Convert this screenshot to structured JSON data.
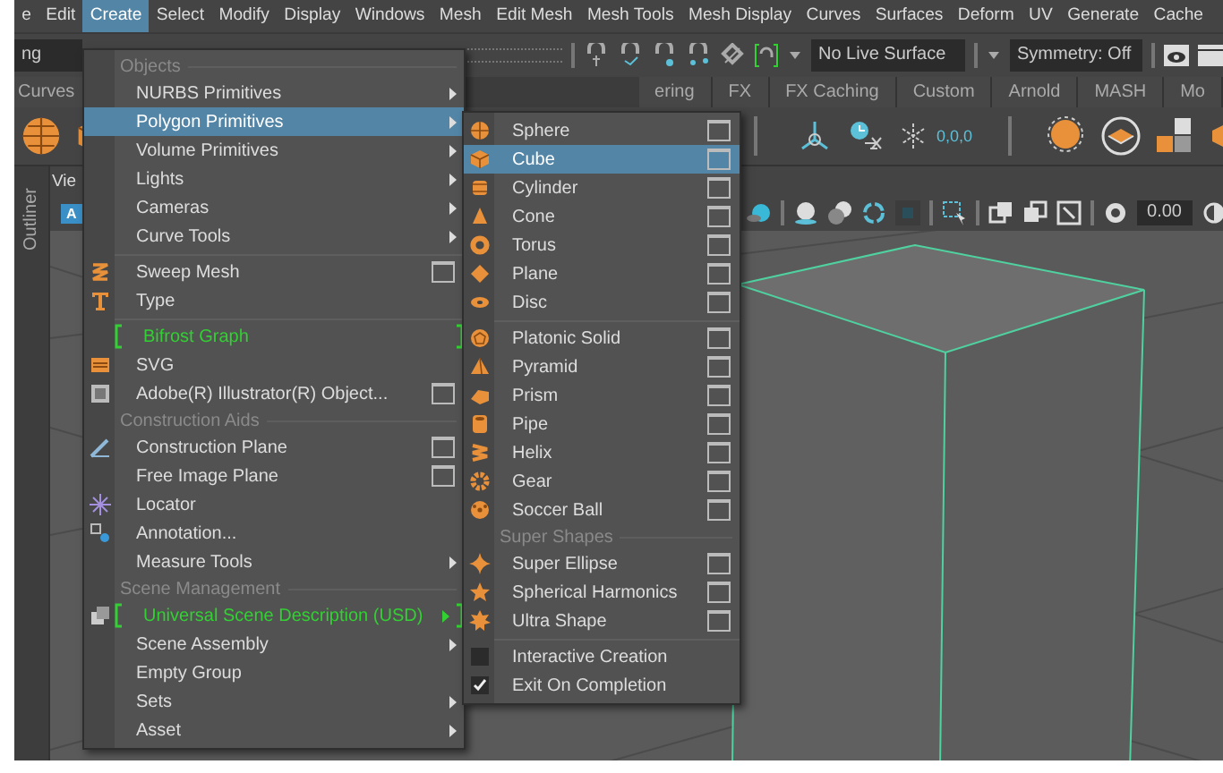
{
  "menubar": [
    {
      "label": "e",
      "selected": false
    },
    {
      "label": "Edit",
      "selected": false
    },
    {
      "label": "Create",
      "selected": true
    },
    {
      "label": "Select",
      "selected": false
    },
    {
      "label": "Modify",
      "selected": false
    },
    {
      "label": "Display",
      "selected": false
    },
    {
      "label": "Windows",
      "selected": false
    },
    {
      "label": "Mesh",
      "selected": false
    },
    {
      "label": "Edit Mesh",
      "selected": false
    },
    {
      "label": "Mesh Tools",
      "selected": false
    },
    {
      "label": "Mesh Display",
      "selected": false
    },
    {
      "label": "Curves",
      "selected": false
    },
    {
      "label": "Surfaces",
      "selected": false
    },
    {
      "label": "Deform",
      "selected": false
    },
    {
      "label": "UV",
      "selected": false
    },
    {
      "label": "Generate",
      "selected": false
    },
    {
      "label": "Cache",
      "selected": false
    }
  ],
  "toolbar": {
    "field": "ng",
    "live_surface": "No Live Surface",
    "symmetry": "Symmetry: Off"
  },
  "shelf_tabs": [
    "Curves",
    "ering",
    "FX",
    "FX Caching",
    "Custom",
    "Arnold",
    "MASH",
    "Mo"
  ],
  "shelf": {
    "origin_reading": "0,0,0"
  },
  "outliner_tab": "Outliner",
  "viewport": {
    "panel_menu": "Vie",
    "badge": "A",
    "camera_value": "0.00"
  },
  "create_menu": {
    "items": [
      {
        "kind": "section",
        "label": "Objects"
      },
      {
        "kind": "item",
        "label": "NURBS Primitives",
        "selected": false,
        "submenu": true
      },
      {
        "kind": "item",
        "label": "Polygon Primitives",
        "selected": true,
        "submenu": true
      },
      {
        "kind": "item",
        "label": "Volume Primitives",
        "selected": false,
        "submenu": true
      },
      {
        "kind": "item",
        "label": "Lights",
        "selected": false,
        "submenu": true
      },
      {
        "kind": "item",
        "label": "Cameras",
        "selected": false,
        "submenu": true
      },
      {
        "kind": "item",
        "label": "Curve Tools",
        "selected": false,
        "submenu": true
      },
      {
        "kind": "divider"
      },
      {
        "kind": "item",
        "label": "Sweep Mesh",
        "selected": false,
        "option_box": true
      },
      {
        "kind": "item",
        "label": "Type",
        "selected": false
      },
      {
        "kind": "divider"
      },
      {
        "kind": "item",
        "label": "Bifrost Graph",
        "selected": false,
        "plugin": true
      },
      {
        "kind": "item",
        "label": "SVG",
        "selected": false
      },
      {
        "kind": "item",
        "label": "Adobe(R) Illustrator(R) Object...",
        "selected": false,
        "option_box": true
      },
      {
        "kind": "section",
        "label": "Construction Aids"
      },
      {
        "kind": "item",
        "label": "Construction Plane",
        "selected": false,
        "option_box": true
      },
      {
        "kind": "item",
        "label": "Free Image Plane",
        "selected": false,
        "option_box": true
      },
      {
        "kind": "item",
        "label": "Locator",
        "selected": false
      },
      {
        "kind": "item",
        "label": "Annotation...",
        "selected": false
      },
      {
        "kind": "item",
        "label": "Measure Tools",
        "selected": false,
        "submenu": true
      },
      {
        "kind": "section",
        "label": "Scene Management"
      },
      {
        "kind": "item",
        "label": "Universal Scene Description (USD)",
        "selected": false,
        "submenu": true,
        "plugin": true
      },
      {
        "kind": "item",
        "label": "Scene Assembly",
        "selected": false,
        "submenu": true
      },
      {
        "kind": "item",
        "label": "Empty Group",
        "selected": false
      },
      {
        "kind": "item",
        "label": "Sets",
        "selected": false,
        "submenu": true
      },
      {
        "kind": "item",
        "label": "Asset",
        "selected": false,
        "submenu": true
      }
    ]
  },
  "submenu": {
    "items": [
      {
        "kind": "item",
        "label": "Sphere",
        "selected": false,
        "option_box": true
      },
      {
        "kind": "item",
        "label": "Cube",
        "selected": true,
        "option_box": true
      },
      {
        "kind": "item",
        "label": "Cylinder",
        "selected": false,
        "option_box": true
      },
      {
        "kind": "item",
        "label": "Cone",
        "selected": false,
        "option_box": true
      },
      {
        "kind": "item",
        "label": "Torus",
        "selected": false,
        "option_box": true
      },
      {
        "kind": "item",
        "label": "Plane",
        "selected": false,
        "option_box": true
      },
      {
        "kind": "item",
        "label": "Disc",
        "selected": false,
        "option_box": true
      },
      {
        "kind": "divider"
      },
      {
        "kind": "item",
        "label": "Platonic Solid",
        "selected": false,
        "option_box": true
      },
      {
        "kind": "item",
        "label": "Pyramid",
        "selected": false,
        "option_box": true
      },
      {
        "kind": "item",
        "label": "Prism",
        "selected": false,
        "option_box": true
      },
      {
        "kind": "item",
        "label": "Pipe",
        "selected": false,
        "option_box": true
      },
      {
        "kind": "item",
        "label": "Helix",
        "selected": false,
        "option_box": true
      },
      {
        "kind": "item",
        "label": "Gear",
        "selected": false,
        "option_box": true
      },
      {
        "kind": "item",
        "label": "Soccer Ball",
        "selected": false,
        "option_box": true
      },
      {
        "kind": "section",
        "label": "Super Shapes"
      },
      {
        "kind": "item",
        "label": "Super Ellipse",
        "selected": false,
        "option_box": true
      },
      {
        "kind": "item",
        "label": "Spherical Harmonics",
        "selected": false,
        "option_box": true
      },
      {
        "kind": "item",
        "label": "Ultra Shape",
        "selected": false,
        "option_box": true
      },
      {
        "kind": "divider"
      },
      {
        "kind": "check",
        "label": "Interactive Creation",
        "checked": false
      },
      {
        "kind": "check",
        "label": "Exit On Completion",
        "checked": true
      }
    ]
  }
}
